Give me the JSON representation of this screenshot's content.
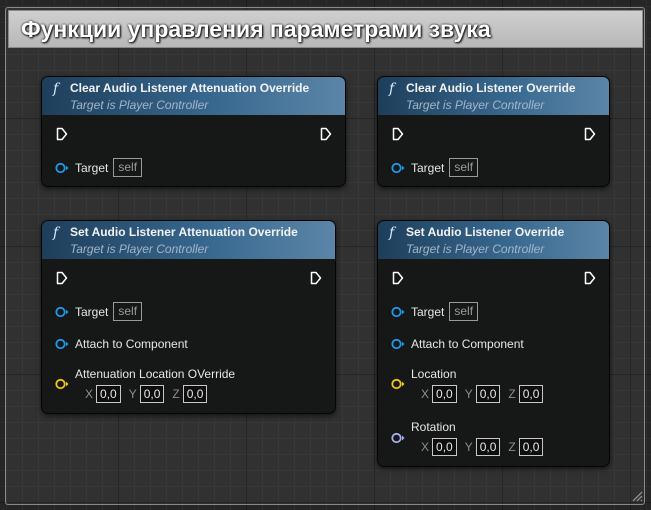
{
  "comment": {
    "title": "Функции управления параметрами звука"
  },
  "nodes": [
    {
      "title": "Clear Audio Listener Attenuation Override",
      "subtitle": "Target is Player Controller",
      "target_label": "Target",
      "target_value": "self"
    },
    {
      "title": "Clear Audio Listener Override",
      "subtitle": "Target is Player Controller",
      "target_label": "Target",
      "target_value": "self"
    },
    {
      "title": "Set Audio Listener Attenuation Override",
      "subtitle": "Target is Player Controller",
      "target_label": "Target",
      "target_value": "self",
      "attach_label": "Attach to Component",
      "location_label": "Attenuation Location OVerride",
      "location": {
        "x_label": "X",
        "x": "0,0",
        "y_label": "Y",
        "y": "0,0",
        "z_label": "Z",
        "z": "0,0"
      }
    },
    {
      "title": "Set Audio Listener Override",
      "subtitle": "Target is Player Controller",
      "target_label": "Target",
      "target_value": "self",
      "attach_label": "Attach to Component",
      "location_label": "Location",
      "location": {
        "x_label": "X",
        "x": "0,0",
        "y_label": "Y",
        "y": "0,0",
        "z_label": "Z",
        "z": "0,0"
      },
      "rotation_label": "Rotation",
      "rotation": {
        "x_label": "X",
        "x": "0,0",
        "y_label": "Y",
        "y": "0,0",
        "z_label": "Z",
        "z": "0,0"
      }
    }
  ],
  "icons": {
    "function": "function-icon",
    "exec": "exec-pin-icon",
    "object_pin": "object-pin-icon",
    "vector_pin": "vector-pin-icon",
    "rotator_pin": "rotator-pin-icon"
  },
  "colors": {
    "object_pin": "#1e9be8",
    "vector_pin": "#f2c618",
    "rotator_pin": "#a6b0f0",
    "header_blue": "#37678e"
  }
}
